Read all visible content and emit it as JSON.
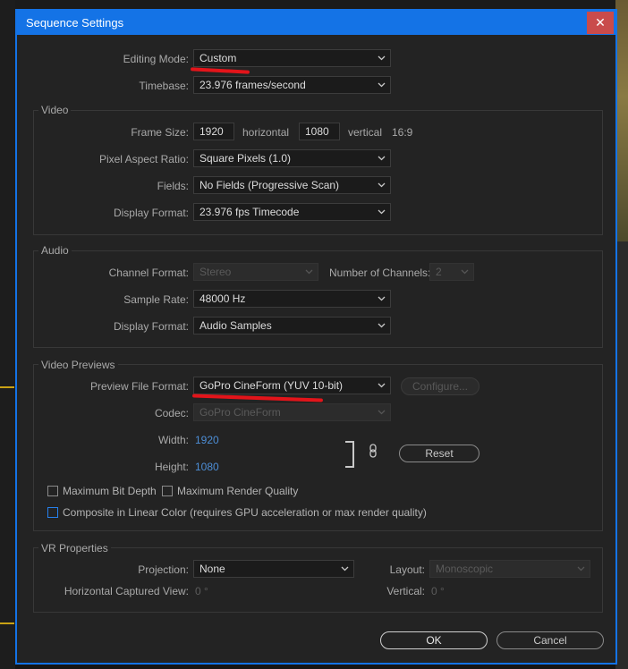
{
  "dialog": {
    "title": "Sequence Settings",
    "close_glyph": "✕"
  },
  "general": {
    "editing_mode_label": "Editing Mode:",
    "editing_mode_value": "Custom",
    "timebase_label": "Timebase:",
    "timebase_value": "23.976  frames/second"
  },
  "video": {
    "title": "Video",
    "frame_size_label": "Frame Size:",
    "frame_width": "1920",
    "horizontal_label": "horizontal",
    "frame_height": "1080",
    "vertical_label": "vertical",
    "aspect_ratio": "16:9",
    "pixel_aspect_label": "Pixel Aspect Ratio:",
    "pixel_aspect_value": "Square Pixels (1.0)",
    "fields_label": "Fields:",
    "fields_value": "No Fields (Progressive Scan)",
    "display_format_label": "Display Format:",
    "display_format_value": "23.976 fps Timecode"
  },
  "audio": {
    "title": "Audio",
    "channel_format_label": "Channel Format:",
    "channel_format_value": "Stereo",
    "num_channels_label": "Number of Channels:",
    "num_channels_value": "2",
    "sample_rate_label": "Sample Rate:",
    "sample_rate_value": "48000 Hz",
    "display_format_label": "Display Format:",
    "display_format_value": "Audio Samples"
  },
  "previews": {
    "title": "Video Previews",
    "preview_format_label": "Preview File Format:",
    "preview_format_value": "GoPro CineForm (YUV 10-bit)",
    "configure_label": "Configure...",
    "codec_label": "Codec:",
    "codec_value": "GoPro CineForm",
    "width_label": "Width:",
    "width_value": "1920",
    "height_label": "Height:",
    "height_value": "1080",
    "reset_label": "Reset",
    "max_bit_depth_label": "Maximum Bit Depth",
    "max_render_quality_label": "Maximum Render Quality",
    "linear_color_label": "Composite in Linear Color (requires GPU  acceleration or max render quality)"
  },
  "vr": {
    "title": "VR Properties",
    "projection_label": "Projection:",
    "projection_value": "None",
    "layout_label": "Layout:",
    "layout_value": "Monoscopic",
    "h_captured_label": "Horizontal Captured View:",
    "h_captured_value": "0 °",
    "vertical_label": "Vertical:",
    "vertical_value": "0 °"
  },
  "footer": {
    "ok_label": "OK",
    "cancel_label": "Cancel"
  },
  "colors": {
    "accent": "#1473e6",
    "annotation": "#e3141a",
    "close": "#c94b4b"
  }
}
